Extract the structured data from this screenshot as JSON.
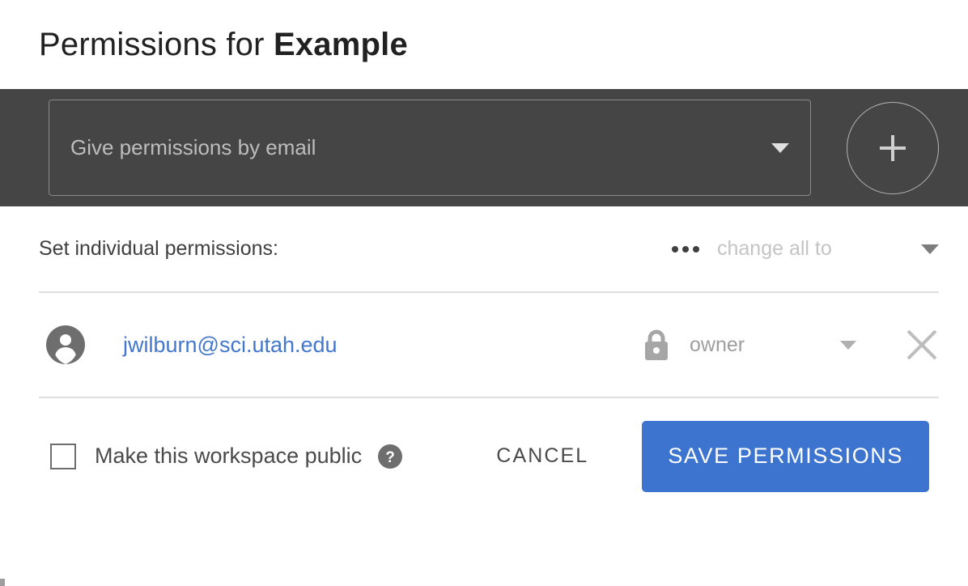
{
  "header": {
    "title_prefix": "Permissions for ",
    "title_subject": "Example"
  },
  "invite": {
    "email_input_placeholder": "Give permissions by email",
    "email_input_value": "",
    "dropdown_icon": "chevron-down-icon",
    "add_button_icon": "plus-icon",
    "add_button_label": "+"
  },
  "permissions": {
    "section_label": "Set individual permissions:",
    "overflow_icon": "more-options-icon",
    "change_all_label": "change all to",
    "change_all_dropdown_icon": "chevron-down-icon",
    "users": [
      {
        "avatar_icon": "user-avatar-icon",
        "email": "jwilburn@sci.utah.edu",
        "role_icon": "lock-icon",
        "role": "owner",
        "role_dropdown_icon": "chevron-down-icon",
        "remove_icon": "close-icon"
      }
    ]
  },
  "footer": {
    "public_checkbox_label": "Make this workspace public",
    "public_checkbox_checked": false,
    "help_icon": "help-circle-icon",
    "help_icon_glyph": "?",
    "cancel_label": "CANCEL",
    "save_label": "SAVE PERMISSIONS"
  },
  "colors": {
    "accent_blue": "#3c74cf",
    "link_blue": "#4377cb",
    "dark_bar": "#454545",
    "divider": "#dfdfdf",
    "muted_text": "#c4c4c4"
  }
}
